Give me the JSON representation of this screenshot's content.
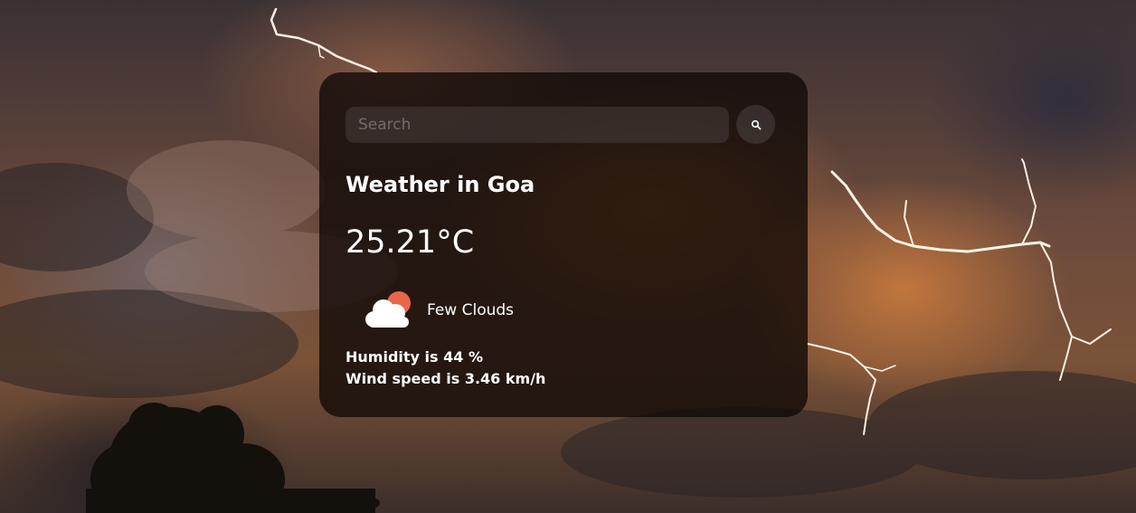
{
  "search": {
    "placeholder": "Search",
    "value": "",
    "button_icon": "search-icon"
  },
  "weather": {
    "title": "Weather in Goa",
    "temperature": "25.21°C",
    "condition_icon": "few-clouds-icon",
    "description": "Few Clouds",
    "humidity_text": "Humidity is 44 %",
    "wind_text": "Wind speed is 3.46 km/h"
  },
  "colors": {
    "card_background": "#120a06",
    "text": "#ffffff",
    "sun": "#e8674a",
    "cloud": "#ffffff"
  }
}
